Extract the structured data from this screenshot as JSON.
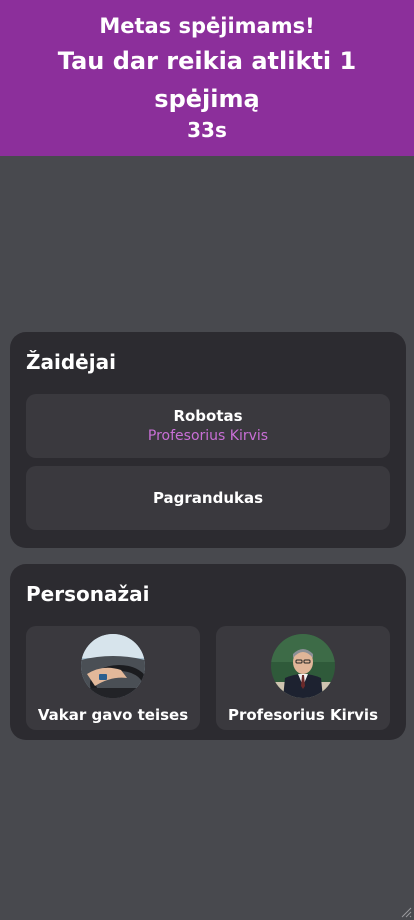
{
  "header": {
    "title": "Metas spėjimams!",
    "subtitle": "Tau dar reikia atlikti 1 spėjimą",
    "timer": "33s",
    "color": "#8c2f9b"
  },
  "players": {
    "heading": "Žaidėjai",
    "items": [
      {
        "name": "Robotas",
        "character": "Profesorius Kirvis"
      },
      {
        "name": "Pagrandukas",
        "character": ""
      }
    ]
  },
  "characters": {
    "heading": "Personažai",
    "items": [
      {
        "name": "Vakar gavo teises",
        "image": "driving-car-avatar"
      },
      {
        "name": "Profesorius Kirvis",
        "image": "professor-avatar"
      }
    ]
  },
  "accent_color": "#c86fd6"
}
